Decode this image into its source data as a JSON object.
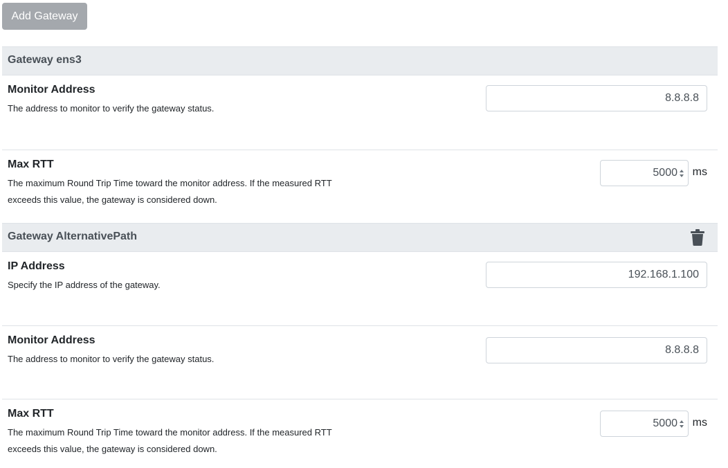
{
  "toolbar": {
    "add_gateway_label": "Add Gateway"
  },
  "gateways": [
    {
      "title": "Gateway ens3",
      "fields": {
        "monitor_address": {
          "label": "Monitor Address",
          "description": "The address to monitor to verify the gateway status.",
          "value": "8.8.8.8"
        },
        "max_rtt": {
          "label": "Max RTT",
          "description": "The maximum Round Trip Time toward the monitor address. If the measured RTT exceeds this value, the gateway is considered down.",
          "value": "5000",
          "unit": "ms"
        }
      }
    },
    {
      "title": "Gateway AlternativePath",
      "delete_icon": "trash-icon",
      "fields": {
        "ip_address": {
          "label": "IP Address",
          "description": "Specify the IP address of the gateway.",
          "value": "192.168.1.100"
        },
        "monitor_address": {
          "label": "Monitor Address",
          "description": "The address to monitor to verify the gateway status.",
          "value": "8.8.8.8"
        },
        "max_rtt": {
          "label": "Max RTT",
          "description": "The maximum Round Trip Time toward the monitor address. If the measured RTT exceeds this value, the gateway is considered down.",
          "value": "5000",
          "unit": "ms"
        }
      }
    }
  ],
  "colors": {
    "header_bg": "#e9ecef",
    "button_bg": "#a4a8ad",
    "border": "#dee2e6"
  }
}
